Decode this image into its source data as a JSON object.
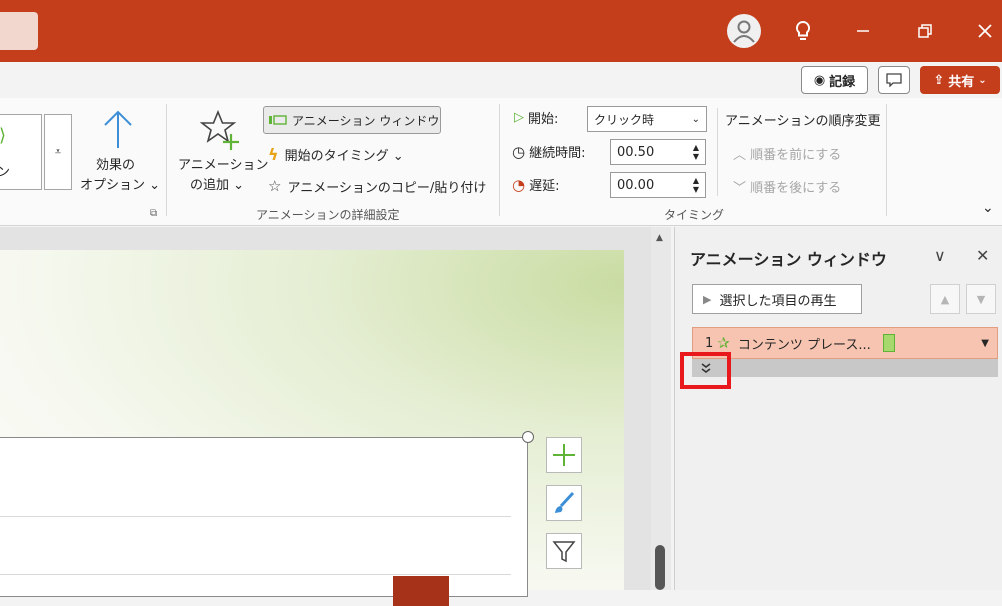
{
  "colors": {
    "brand": "#c43e1c",
    "selected_item": "#f6c4b0",
    "highlight": "#e8181c"
  },
  "command_bar": {
    "record_label": "記録",
    "share_label": "共有"
  },
  "ribbon": {
    "gallery_partial_label": "ン",
    "effect_options_label_1": "効果の",
    "effect_options_label_2": "オプション ⌄",
    "add_animation_label_1": "アニメーション",
    "add_animation_label_2": "の追加 ⌄",
    "animation_pane_label": "アニメーション ウィンドウ",
    "trigger_label": "開始のタイミング ⌄",
    "painter_label": "アニメーションのコピー/貼り付け",
    "advanced_group_label": "アニメーションの詳細設定",
    "start_label": "開始:",
    "start_value": "クリック時",
    "duration_label": "継続時間:",
    "duration_value": "00.50",
    "delay_label": "遅延:",
    "delay_value": "00.00",
    "timing_group_label": "タイミング",
    "reorder_title": "アニメーションの順序変更",
    "move_earlier_label": "順番を前にする",
    "move_later_label": "順番を後にする"
  },
  "animation_pane": {
    "title": "アニメーション ウィンドウ",
    "play_button_label": "選択した項目の再生",
    "items": [
      {
        "number": "1",
        "label": "コンテンツ プレース..."
      }
    ]
  }
}
